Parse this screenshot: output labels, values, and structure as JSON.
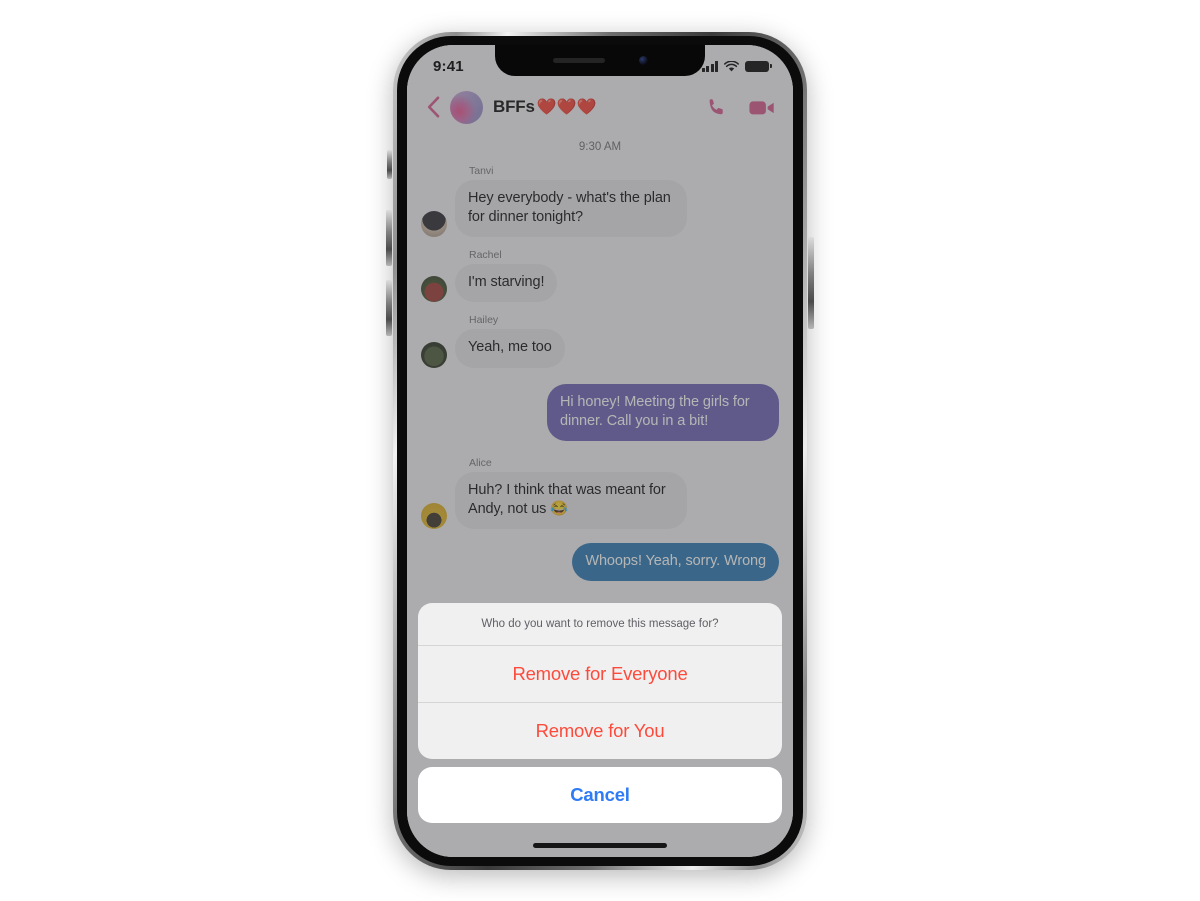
{
  "status_bar": {
    "time": "9:41",
    "signal_icon": "cellular-bars-icon",
    "wifi_icon": "wifi-icon",
    "battery_icon": "battery-icon"
  },
  "chat_header": {
    "back_icon": "chevron-left-icon",
    "avatar_name": "group-avatar",
    "title": "BFFs",
    "title_emoji": "❤️❤️❤️",
    "call_icon": "phone-call-icon",
    "video_icon": "video-camera-icon"
  },
  "conversation": {
    "timestamp": "9:30 AM",
    "messages": [
      {
        "sender": "Tanvi",
        "text": "Hey everybody - what's the plan for dinner tonight?",
        "direction": "incoming",
        "style": "grey",
        "avatar": "avatar-tanvi"
      },
      {
        "sender": "Rachel",
        "text": "I'm starving!",
        "direction": "incoming",
        "style": "grey",
        "avatar": "avatar-rachel"
      },
      {
        "sender": "Hailey",
        "text": "Yeah, me too",
        "direction": "incoming",
        "style": "grey",
        "avatar": "avatar-hailey"
      },
      {
        "sender": "",
        "text": "Hi honey! Meeting the girls for dinner. Call you in a bit!",
        "direction": "outgoing",
        "style": "purple",
        "avatar": ""
      },
      {
        "sender": "Alice",
        "text": "Huh? I think that was meant for Andy, not us 😂",
        "direction": "incoming",
        "style": "grey",
        "avatar": "avatar-alice"
      },
      {
        "sender": "",
        "text": "Whoops! Yeah, sorry. Wrong",
        "direction": "outgoing",
        "style": "blue",
        "avatar": ""
      }
    ]
  },
  "action_sheet": {
    "message": "Who do you want to remove this message for?",
    "actions": [
      {
        "label": "Remove for Everyone"
      },
      {
        "label": "Remove for You"
      }
    ],
    "cancel_label": "Cancel"
  },
  "colors": {
    "destructive": "#fc4b3c",
    "cancel_blue": "#2f7bf6",
    "outgoing_purple": "#6b63b5",
    "outgoing_blue": "#2b79b4",
    "incoming_grey": "#e4e4e9",
    "header_pink": "#d65a8f"
  }
}
